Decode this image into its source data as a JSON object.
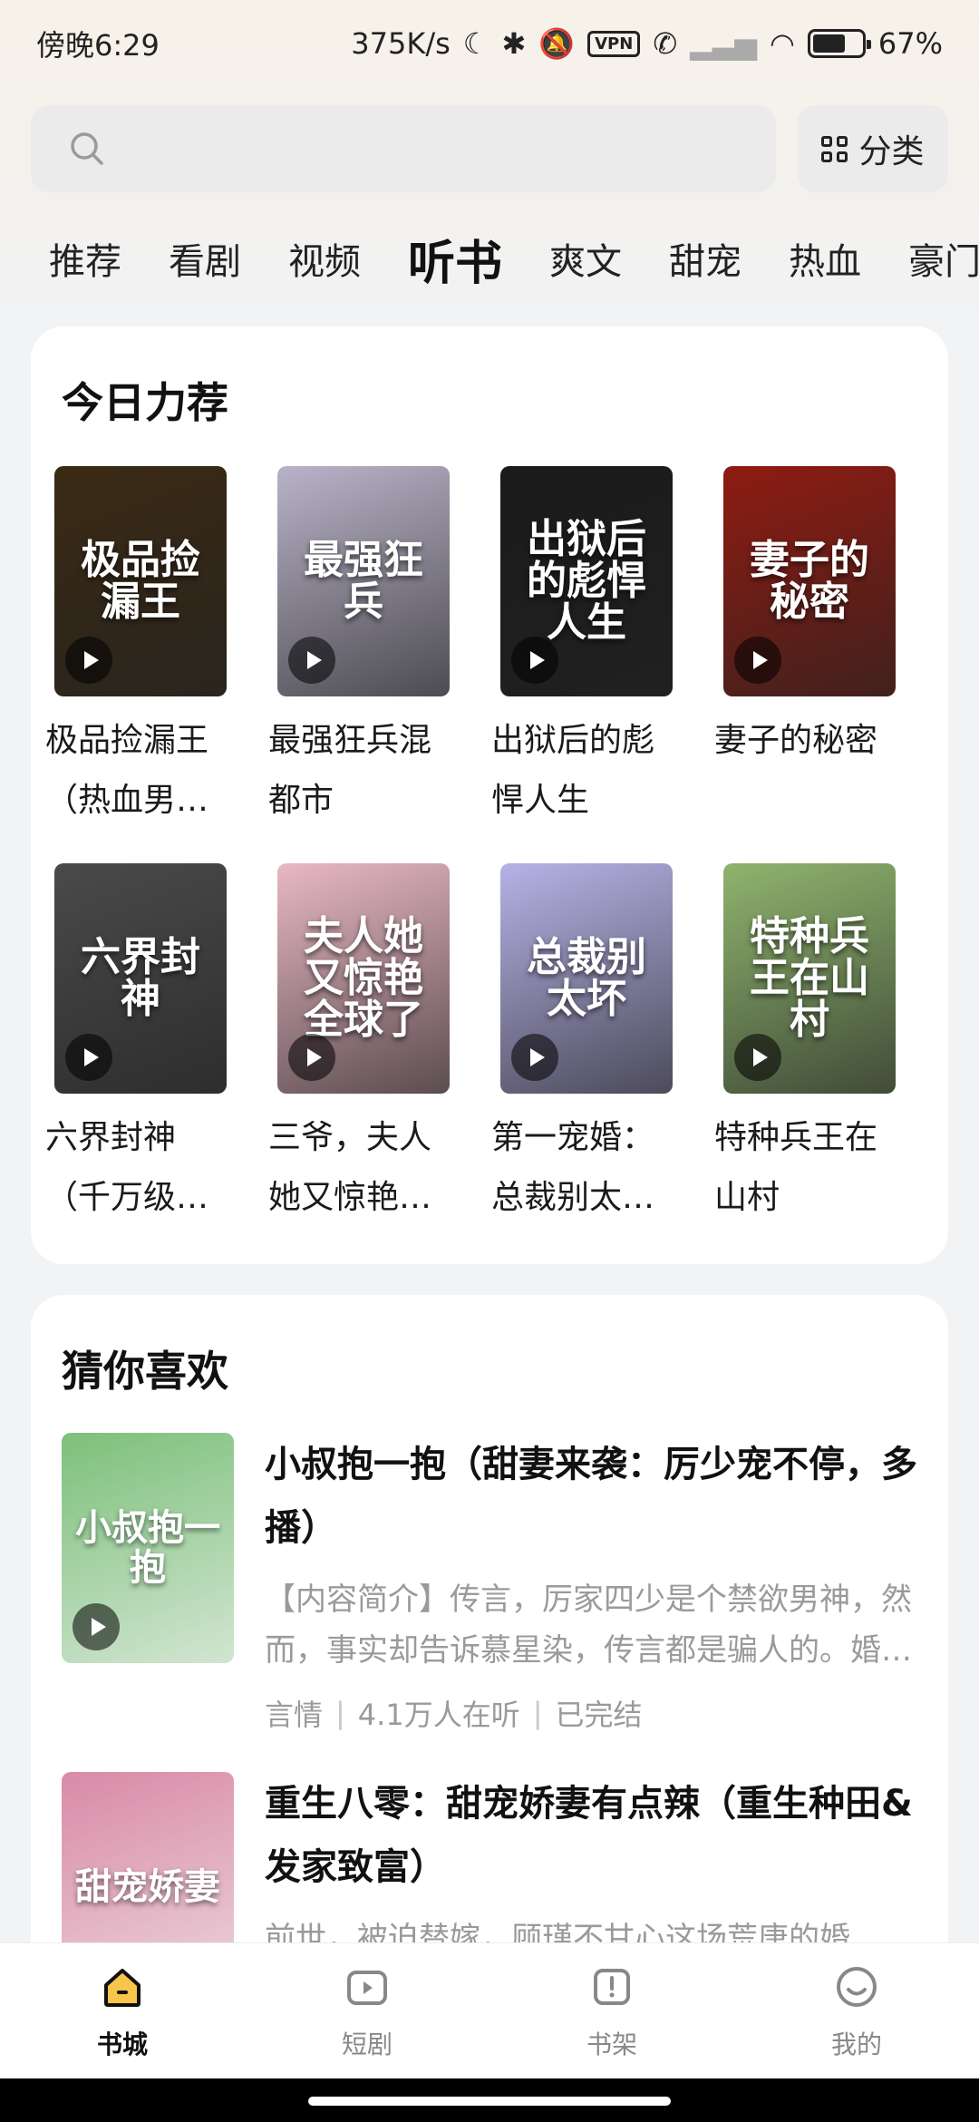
{
  "status": {
    "time": "傍晚6:29",
    "speed": "375K/s",
    "vpn": "VPN",
    "battery": "67%",
    "battery_level": 0.67
  },
  "search": {
    "placeholder": "",
    "category_label": "分类"
  },
  "tabs": [
    {
      "label": "推荐",
      "active": false
    },
    {
      "label": "看剧",
      "active": false
    },
    {
      "label": "视频",
      "active": false
    },
    {
      "label": "听书",
      "active": true
    },
    {
      "label": "爽文",
      "active": false
    },
    {
      "label": "甜宠",
      "active": false
    },
    {
      "label": "热血",
      "active": false
    },
    {
      "label": "豪门",
      "active": false
    }
  ],
  "recommend": {
    "title": "今日力荐",
    "books": [
      {
        "title": "极品捡漏王（热血男…",
        "cover_text": "极品捡漏王",
        "cover_color": "#3a2a14"
      },
      {
        "title": "最强狂兵混都市",
        "cover_text": "最强狂兵",
        "cover_color": "#b9b3c8"
      },
      {
        "title": "出狱后的彪悍人生",
        "cover_text": "出狱后的彪悍人生",
        "cover_color": "#1b1b1b"
      },
      {
        "title": "妻子的秘密",
        "cover_text": "妻子的秘密",
        "cover_color": "#8e1c12"
      },
      {
        "title": "六界封神（千万级…",
        "cover_text": "六界封神",
        "cover_color": "#4a4a4a"
      },
      {
        "title": "三爷，夫人她又惊艳…",
        "cover_text": "夫人她又惊艳全球了",
        "cover_color": "#e9b8c4"
      },
      {
        "title": "第一宠婚：总裁别太…",
        "cover_text": "总裁别太坏",
        "cover_color": "#b6b2e6"
      },
      {
        "title": "特种兵王在山村",
        "cover_text": "特种兵王在山村",
        "cover_color": "#8fb46e"
      }
    ]
  },
  "guess": {
    "title": "猜你喜欢",
    "items": [
      {
        "title": "小叔抱一抱（甜妻来袭：厉少宠不停，多播）",
        "desc": "【内容简介】传言，厉家四少是个禁欲男神，然而，事实却告诉慕星染，传言都是骗人的。婚后……",
        "genre": "言情",
        "listeners": "4.1万人在听",
        "state": "已完结",
        "cover_text": "小叔抱一抱",
        "cover_color": "#7cc07a"
      },
      {
        "title": "重生八零：甜宠娇妻有点辣（重生种田&发家致富）",
        "desc": "前世，被迫替嫁，顾瑾不甘心这场荒唐的婚姻……",
        "genre": "",
        "listeners": "",
        "state": "",
        "cover_text": "甜宠娇妻",
        "cover_color": "#d98aa6"
      }
    ]
  },
  "nav": [
    {
      "label": "书城",
      "icon": "home-icon",
      "active": true
    },
    {
      "label": "短剧",
      "icon": "video-play-icon",
      "active": false
    },
    {
      "label": "书架",
      "icon": "bookshelf-icon",
      "active": false
    },
    {
      "label": "我的",
      "icon": "profile-icon",
      "active": false
    }
  ],
  "colors": {
    "accent": "#f6c64c",
    "background": "#f2f3f5"
  }
}
